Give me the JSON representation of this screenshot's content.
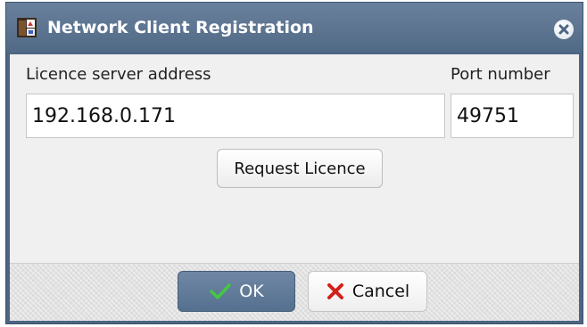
{
  "window": {
    "title": "Network Client Registration",
    "icons": {
      "app": "app-logo-icon",
      "close": "close-icon"
    }
  },
  "form": {
    "server_label": "Licence server address",
    "server_value": "192.168.0.171",
    "port_label": "Port number",
    "port_value": "49751",
    "request_button": "Request Licence"
  },
  "footer": {
    "ok_label": "OK",
    "ok_icon": "checkmark-icon",
    "cancel_label": "Cancel",
    "cancel_icon": "x-mark-icon"
  },
  "colors": {
    "titlebar": "#5b7491",
    "ok_button": "#617b99",
    "check_green": "#43c843",
    "cancel_red": "#d4201b"
  }
}
